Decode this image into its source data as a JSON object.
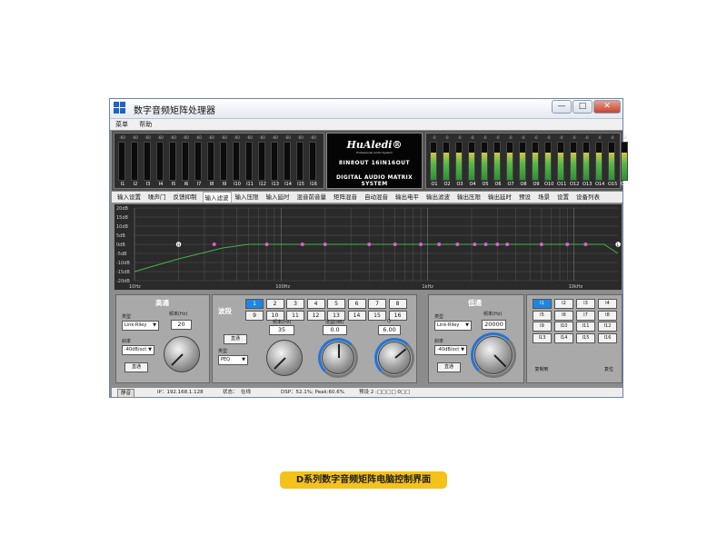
{
  "window": {
    "title": "数字音频矩阵处理器",
    "min_label": "—",
    "max_label": "□",
    "close_label": "✕"
  },
  "menu": [
    "菜单",
    "帮助"
  ],
  "input_meters": {
    "value_label": "-60",
    "channels": [
      "I1",
      "I2",
      "I3",
      "I4",
      "I5",
      "I6",
      "I7",
      "I8",
      "I9",
      "I10",
      "I11",
      "I12",
      "I13",
      "I14",
      "I15",
      "I16"
    ],
    "levels": [
      0,
      0,
      0,
      0,
      0,
      0,
      0,
      0,
      0,
      0,
      0,
      0,
      0,
      0,
      0,
      0
    ]
  },
  "output_meters": {
    "value_label": "-0",
    "channels": [
      "O1",
      "O2",
      "O3",
      "O4",
      "O5",
      "O6",
      "O7",
      "O8",
      "O9",
      "O10",
      "O11",
      "O12",
      "O13",
      "O14",
      "O15",
      "O16"
    ],
    "levels": [
      0.72,
      0.72,
      0.72,
      0.72,
      0.72,
      0.72,
      0.72,
      0.72,
      0.72,
      0.72,
      0.72,
      0.72,
      0.72,
      0.72,
      0.72,
      0.72
    ]
  },
  "logo": {
    "brand": "HuAledi®",
    "brand_sub": "Professional Audio System",
    "line1": "8IN8OUT 16IN16OUT",
    "line2": "DIGITAL AUDIO MATRIX SYSTEM"
  },
  "tabs": [
    "输入设置",
    "噪声门",
    "反馈抑制",
    "输入滤波",
    "输入压限",
    "输入延时",
    "混音前音量",
    "矩阵混音",
    "自动混音",
    "输出电平",
    "输出滤波",
    "输出压限",
    "输出延时",
    "预设",
    "场景",
    "设置",
    "设备列表"
  ],
  "active_tab": 3,
  "eq_graph": {
    "y_labels": [
      "20dB",
      "15dB",
      "10dB",
      "5dB",
      "0dB",
      "-5dB",
      "-10dB",
      "-15dB",
      "-20dB"
    ],
    "x_labels": [
      "10Hz",
      "100Hz",
      "1kHz",
      "10kHz"
    ],
    "ymin": -20,
    "ymax": 20,
    "xmin_log": 1,
    "xmax_log": 4.3,
    "curve": [
      [
        10,
        -15
      ],
      [
        20,
        -8
      ],
      [
        40,
        -2
      ],
      [
        60,
        0
      ],
      [
        1000,
        0
      ],
      [
        10000,
        0
      ],
      [
        16000,
        0
      ],
      [
        20000,
        -5
      ]
    ],
    "band_points": [
      35,
      80,
      140,
      200,
      400,
      600,
      900,
      1200,
      1600,
      2100,
      2500,
      3000,
      3500,
      6000,
      9000,
      12000
    ],
    "hp_marker": {
      "freq": 20,
      "label": "H"
    },
    "lp_marker": {
      "freq": 20000,
      "label": "L"
    }
  },
  "highpass": {
    "title": "高通",
    "type_label": "类型",
    "type_value": "Link-Riley",
    "freq_label": "频率(Hz)",
    "freq_value": "20",
    "slope_label": "斜率",
    "slope_value": "-40dB/oct",
    "bypass_label": "直通"
  },
  "eqband": {
    "title": "波段",
    "bands": [
      "1",
      "2",
      "3",
      "4",
      "5",
      "6",
      "7",
      "8",
      "9",
      "10",
      "11",
      "12",
      "13",
      "14",
      "15",
      "16"
    ],
    "active_band": "1",
    "bypass_label": "直通",
    "type_label": "类型",
    "type_value": "PEQ",
    "freq_label": "频率(Hz)",
    "freq_value": "35",
    "gain_label": "增益(dB)",
    "gain_value": "0.0",
    "q_label": "Q",
    "q_value": "6.00"
  },
  "lowpass": {
    "title": "低通",
    "type_label": "类型",
    "type_value": "Link-Riley",
    "freq_label": "频率(Hz)",
    "freq_value": "20000",
    "slope_label": "斜率",
    "slope_value": "-40dB/oct",
    "bypass_label": "直通"
  },
  "outputs": {
    "buttons": [
      "I1",
      "I2",
      "I3",
      "I4",
      "I5",
      "I6",
      "I7",
      "I8",
      "I9",
      "I10",
      "I11",
      "I12",
      "I13",
      "I14",
      "I15",
      "I16"
    ],
    "active": "I1",
    "copy_label": "复制到",
    "reset_label": "复位"
  },
  "status": {
    "mute_label": "静音",
    "ip": "IP：192.168.1.128",
    "state_label": "状态：",
    "state_value": "在线",
    "dsp": "DSP：52.1%; Peak:60.6%",
    "preset": "预设 2 :□□□□ 0□□"
  },
  "caption": "D系列数字音频矩阵电脑控制界面"
}
